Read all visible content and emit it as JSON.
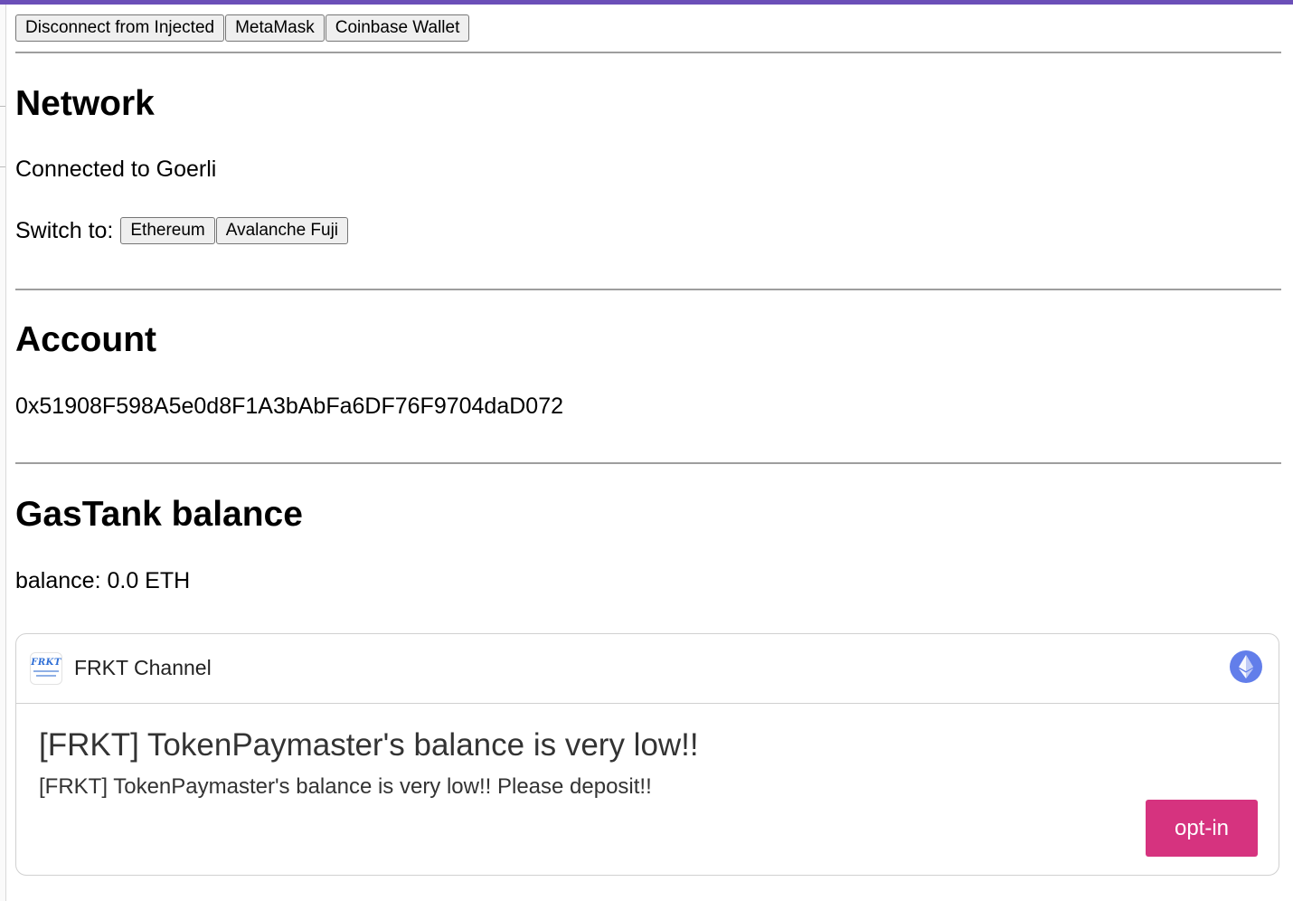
{
  "wallet_buttons": {
    "disconnect": "Disconnect from Injected",
    "metamask": "MetaMask",
    "coinbase": "Coinbase Wallet"
  },
  "network": {
    "heading": "Network",
    "status": "Connected to Goerli",
    "switch_label": "Switch to:",
    "options": [
      "Ethereum",
      "Avalanche Fuji"
    ]
  },
  "account": {
    "heading": "Account",
    "address": "0x51908F598A5e0d8F1A3bAbFa6DF76F9704daD072"
  },
  "gastank": {
    "heading": "GasTank balance",
    "balance": "balance: 0.0 ETH"
  },
  "notification": {
    "channel_logo_text": "FRKT",
    "channel_name": "FRKT Channel",
    "title": "[FRKT] TokenPaymaster's balance is very low!!",
    "body": "[FRKT] TokenPaymaster's balance is very low!! Please deposit!!",
    "optin_label": "opt-in",
    "chain_icon": "ethereum-icon",
    "colors": {
      "chain_icon_bg": "#627eea",
      "optin_bg": "#d6337f"
    }
  },
  "colors": {
    "top_bar": "#6b4fb8"
  }
}
